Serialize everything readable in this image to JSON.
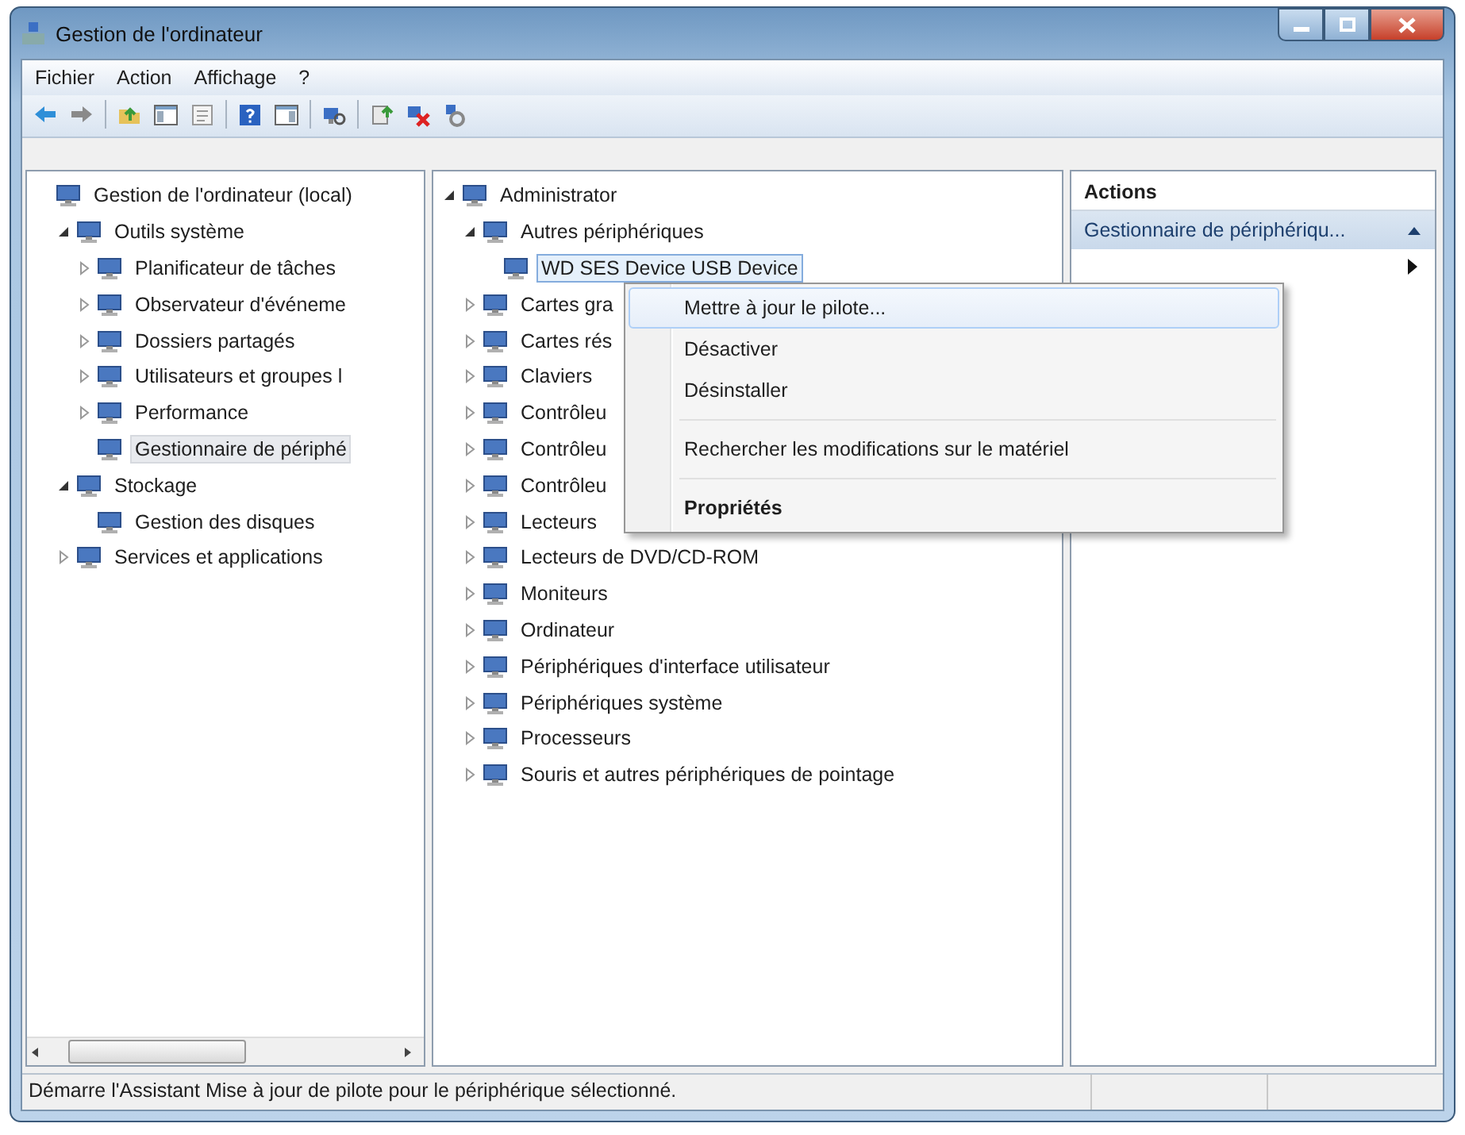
{
  "window": {
    "title": "Gestion de l'ordinateur"
  },
  "menu_bar": [
    "Fichier",
    "Action",
    "Affichage",
    "?"
  ],
  "console_tree": {
    "items": [
      {
        "label": "Gestion de l'ordinateur (local)",
        "selected": false,
        "children": [
          {
            "label": "Outils système",
            "expanded": true,
            "selected": false,
            "children": [
              {
                "label": "Planificateur de tâches",
                "expanded": false,
                "selected": false
              },
              {
                "label": "Observateur d'événeme",
                "expanded": false,
                "selected": false
              },
              {
                "label": "Dossiers partagés",
                "expanded": false,
                "selected": false
              },
              {
                "label": "Utilisateurs et groupes l",
                "expanded": false,
                "selected": false
              },
              {
                "label": "Performance",
                "expanded": false,
                "selected": false
              },
              {
                "label": "Gestionnaire de périphé",
                "selected": true
              }
            ]
          },
          {
            "label": "Stockage",
            "expanded": true,
            "selected": false,
            "children": [
              {
                "label": "Gestion des disques",
                "selected": false
              }
            ]
          },
          {
            "label": "Services et applications",
            "expanded": false,
            "selected": false
          }
        ]
      }
    ]
  },
  "device_tree": {
    "items": [
      {
        "label": "Administrator",
        "expanded": true,
        "selected": false,
        "children": [
          {
            "label": "Autres périphériques",
            "expanded": true,
            "selected": false,
            "children": [
              {
                "label": "WD SES Device USB Device",
                "selected": true
              }
            ]
          },
          {
            "label": "Cartes gra",
            "expanded": false,
            "selected": false
          },
          {
            "label": "Cartes rés",
            "expanded": false,
            "selected": false
          },
          {
            "label": "Claviers",
            "expanded": false,
            "selected": false
          },
          {
            "label": "Contrôleu",
            "expanded": false,
            "selected": false
          },
          {
            "label": "Contrôleu",
            "expanded": false,
            "selected": false
          },
          {
            "label": "Contrôleu",
            "expanded": false,
            "selected": false
          },
          {
            "label": "Lecteurs",
            "expanded": false,
            "selected": false
          },
          {
            "label": "Lecteurs de DVD/CD-ROM",
            "expanded": false,
            "selected": false
          },
          {
            "label": "Moniteurs",
            "expanded": false,
            "selected": false
          },
          {
            "label": "Ordinateur",
            "expanded": false,
            "selected": false
          },
          {
            "label": "Périphériques d'interface utilisateur",
            "expanded": false,
            "selected": false
          },
          {
            "label": "Périphériques système",
            "expanded": false,
            "selected": false
          },
          {
            "label": "Processeurs",
            "expanded": false,
            "selected": false
          },
          {
            "label": "Souris et autres périphériques de pointage",
            "expanded": false,
            "selected": false
          }
        ]
      }
    ]
  },
  "actions_pane": {
    "title": "Actions",
    "section": {
      "label": "Gestionnaire de périphériqu...",
      "expanded": true
    }
  },
  "context_menu": [
    {
      "kind": "item",
      "label": "Mettre à jour le pilote...",
      "selected": true,
      "default": false
    },
    {
      "kind": "item",
      "label": "Désactiver",
      "selected": false,
      "default": false
    },
    {
      "kind": "item",
      "label": "Désinstaller",
      "selected": false,
      "default": false
    },
    {
      "kind": "separator"
    },
    {
      "kind": "item",
      "label": "Rechercher les modifications sur le matériel",
      "selected": false,
      "default": false
    },
    {
      "kind": "separator"
    },
    {
      "kind": "item",
      "label": "Propriétés",
      "selected": false,
      "default": true
    }
  ],
  "status_bar": {
    "text": "Démarre l'Assistant Mise à jour de pilote pour le périphérique sélectionné."
  }
}
